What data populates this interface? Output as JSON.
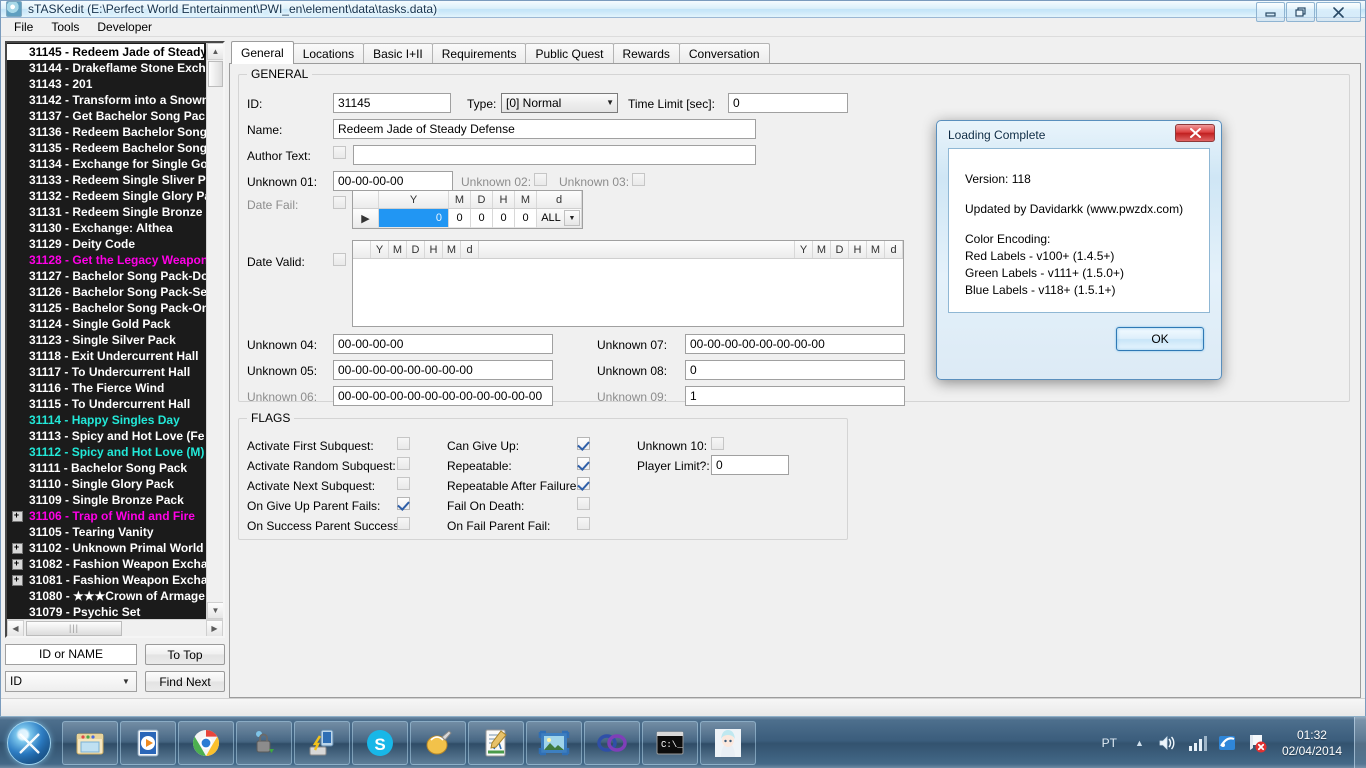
{
  "window": {
    "title": "sTASKedit (E:\\Perfect World Entertainment\\PWI_en\\element\\data\\tasks.data)",
    "minimize_label": "–",
    "restore_label": "❐",
    "close_label": "✕"
  },
  "menu": [
    "File",
    "Tools",
    "Developer"
  ],
  "tree": {
    "items": [
      {
        "label": "31145 - Redeem Jade of Steady",
        "color": "black",
        "selected": true,
        "expandable": false
      },
      {
        "label": "31144 - Drakeflame Stone Exch",
        "color": "white",
        "selected": false,
        "expandable": false
      },
      {
        "label": "31143 - 201",
        "color": "white",
        "selected": false,
        "expandable": false
      },
      {
        "label": "31142 - Transform into a Snowm",
        "color": "white",
        "selected": false,
        "expandable": false
      },
      {
        "label": "31137 - Get Bachelor Song Pac",
        "color": "white",
        "selected": false,
        "expandable": false
      },
      {
        "label": "31136 - Redeem Bachelor Song",
        "color": "white",
        "selected": false,
        "expandable": false
      },
      {
        "label": "31135 - Redeem Bachelor Song",
        "color": "white",
        "selected": false,
        "expandable": false
      },
      {
        "label": "31134 - Exchange for Single Go",
        "color": "white",
        "selected": false,
        "expandable": false
      },
      {
        "label": "31133 - Redeem Single Sliver P",
        "color": "white",
        "selected": false,
        "expandable": false
      },
      {
        "label": "31132 - Redeem Single Glory Pa",
        "color": "white",
        "selected": false,
        "expandable": false
      },
      {
        "label": "31131 - Redeem Single Bronze",
        "color": "white",
        "selected": false,
        "expandable": false
      },
      {
        "label": "31130 - Exchange: Althea",
        "color": "white",
        "selected": false,
        "expandable": false
      },
      {
        "label": "31129 - Deity Code",
        "color": "white",
        "selected": false,
        "expandable": false
      },
      {
        "label": "31128 - Get the Legacy Weapon",
        "color": "magenta",
        "selected": false,
        "expandable": false
      },
      {
        "label": "31127 - Bachelor Song Pack-Do",
        "color": "white",
        "selected": false,
        "expandable": false
      },
      {
        "label": "31126 - Bachelor Song Pack-Se",
        "color": "white",
        "selected": false,
        "expandable": false
      },
      {
        "label": "31125 - Bachelor Song Pack-On",
        "color": "white",
        "selected": false,
        "expandable": false
      },
      {
        "label": "31124 - Single Gold Pack",
        "color": "white",
        "selected": false,
        "expandable": false
      },
      {
        "label": "31123 - Single Silver Pack",
        "color": "white",
        "selected": false,
        "expandable": false
      },
      {
        "label": "31118 - Exit Undercurrent Hall",
        "color": "white",
        "selected": false,
        "expandable": false
      },
      {
        "label": "31117 - To Undercurrent Hall",
        "color": "white",
        "selected": false,
        "expandable": false
      },
      {
        "label": "31116 - The Fierce Wind",
        "color": "white",
        "selected": false,
        "expandable": false
      },
      {
        "label": "31115 - To Undercurrent Hall",
        "color": "white",
        "selected": false,
        "expandable": false
      },
      {
        "label": "31114 - Happy Singles Day",
        "color": "cyan",
        "selected": false,
        "expandable": false
      },
      {
        "label": "31113 - Spicy and Hot Love (Fe",
        "color": "white",
        "selected": false,
        "expandable": false
      },
      {
        "label": "31112 - Spicy and Hot Love (M)",
        "color": "cyan",
        "selected": false,
        "expandable": false
      },
      {
        "label": "31111 - Bachelor Song Pack",
        "color": "white",
        "selected": false,
        "expandable": false
      },
      {
        "label": "31110 - Single Glory Pack",
        "color": "white",
        "selected": false,
        "expandable": false
      },
      {
        "label": "31109 - Single Bronze Pack",
        "color": "white",
        "selected": false,
        "expandable": false
      },
      {
        "label": "31106 - Trap of Wind and Fire",
        "color": "magenta",
        "selected": false,
        "expandable": true
      },
      {
        "label": "31105 - Tearing Vanity",
        "color": "white",
        "selected": false,
        "expandable": false
      },
      {
        "label": "31102 - Unknown Primal World",
        "color": "white",
        "selected": false,
        "expandable": true
      },
      {
        "label": "31082 - Fashion Weapon Excha",
        "color": "white",
        "selected": false,
        "expandable": true
      },
      {
        "label": "31081 - Fashion Weapon Excha",
        "color": "white",
        "selected": false,
        "expandable": true
      },
      {
        "label": "31080 - ★★★Crown of Armage",
        "color": "white",
        "selected": false,
        "expandable": false
      },
      {
        "label": "31079 - Psychic Set",
        "color": "white",
        "selected": false,
        "expandable": false
      }
    ]
  },
  "search": {
    "input_value": "ID or NAME",
    "mode_value": "ID",
    "to_top_label": "To Top",
    "find_next_label": "Find Next"
  },
  "tabs": [
    {
      "label": "General",
      "active": true
    },
    {
      "label": "Locations",
      "active": false
    },
    {
      "label": "Basic I+II",
      "active": false
    },
    {
      "label": "Requirements",
      "active": false
    },
    {
      "label": "Public Quest",
      "active": false
    },
    {
      "label": "Rewards",
      "active": false
    },
    {
      "label": "Conversation",
      "active": false
    }
  ],
  "general": {
    "legend": "GENERAL",
    "id_label": "ID:",
    "id_value": "31145",
    "type_label": "Type:",
    "type_value": "[0] Normal",
    "time_limit_label": "Time Limit [sec]:",
    "time_limit_value": "0",
    "name_label": "Name:",
    "name_value": "Redeem Jade of Steady Defense",
    "author_label": "Author Text:",
    "author_value": "",
    "unknown01_label": "Unknown 01:",
    "unknown01_value": "00-00-00-00",
    "unknown02_label": "Unknown 02:",
    "unknown03_label": "Unknown 03:",
    "date_fail_label": "Date Fail:",
    "date_valid_label": "Date Valid:",
    "date_fail_headers": [
      "",
      "Y",
      "M",
      "D",
      "H",
      "M",
      "d"
    ],
    "date_fail_row": [
      "▶",
      "0",
      "0",
      "0",
      "0",
      "0",
      "ALL"
    ],
    "date_valid_headers_left": [
      "Y",
      "M",
      "D",
      "H",
      "M",
      "d"
    ],
    "date_valid_headers_right": [
      "Y",
      "M",
      "D",
      "H",
      "M",
      "d"
    ],
    "unknown04_label": "Unknown 04:",
    "unknown04_value": "00-00-00-00",
    "unknown05_label": "Unknown 05:",
    "unknown05_value": "00-00-00-00-00-00-00-00",
    "unknown06_label": "Unknown 06:",
    "unknown06_value": "00-00-00-00-00-00-00-00-00-00-00-00",
    "unknown07_label": "Unknown 07:",
    "unknown07_value": "00-00-00-00-00-00-00-00",
    "unknown08_label": "Unknown 08:",
    "unknown08_value": "0",
    "unknown09_label": "Unknown 09:",
    "unknown09_value": "1"
  },
  "flags": {
    "legend": "FLAGS",
    "col1": [
      {
        "label": "Activate First Subquest:",
        "checked": false
      },
      {
        "label": "Activate Random Subquest:",
        "checked": false
      },
      {
        "label": "Activate Next Subquest:",
        "checked": false
      },
      {
        "label": "On Give Up Parent Fails:",
        "checked": true
      },
      {
        "label": "On Success Parent Success:",
        "checked": false
      }
    ],
    "col2": [
      {
        "label": "Can Give Up:",
        "checked": true
      },
      {
        "label": "Repeatable:",
        "checked": true
      },
      {
        "label": "Repeatable After Failure:",
        "checked": true
      },
      {
        "label": "Fail On Death:",
        "checked": false
      },
      {
        "label": "On Fail Parent Fail:",
        "checked": false
      }
    ],
    "col3": {
      "unknown10_label": "Unknown 10:",
      "unknown10_checked": false,
      "player_limit_label": "Player Limit?:",
      "player_limit_value": "0"
    }
  },
  "dialog": {
    "title": "Loading Complete",
    "close_label": "✕",
    "version_line": "Version: 118",
    "updated_line": "Updated by Davidarkk (www.pwzdx.com)",
    "encoding_title": "Color Encoding:",
    "encoding_lines": [
      "Red Labels - v100+ (1.4.5+)",
      "Green Labels - v111+ (1.5.0+)",
      "Blue Labels - v118+ (1.5.1+)"
    ],
    "ok_label": "OK"
  },
  "taskbar": {
    "start_name": "start-orb",
    "apps": [
      {
        "name": "file-explorer-icon"
      },
      {
        "name": "media-player-icon"
      },
      {
        "name": "google-chrome-icon"
      },
      {
        "name": "lock-sync-icon"
      },
      {
        "name": "network-transfer-icon"
      },
      {
        "name": "skype-icon"
      },
      {
        "name": "paint-mouse-icon"
      },
      {
        "name": "notepad-editor-icon"
      },
      {
        "name": "photo-viewer-icon"
      },
      {
        "name": "opera-loop-icon"
      },
      {
        "name": "command-prompt-icon"
      },
      {
        "name": "anime-avatar-icon"
      }
    ],
    "tray": {
      "language": "PT",
      "show_hidden": "▲",
      "volume_icon": "speaker-icon",
      "network_icon": "signal-bars-icon",
      "flag_icon": "action-center-icon",
      "security_icon": "security-alert-icon",
      "time": "01:32",
      "date": "02/04/2014"
    }
  },
  "colors": {
    "accent": "#2196f3",
    "magenta_label": "#ff00e6",
    "cyan_label": "#22e8d8",
    "tree_bg": "#1b1b1b"
  }
}
